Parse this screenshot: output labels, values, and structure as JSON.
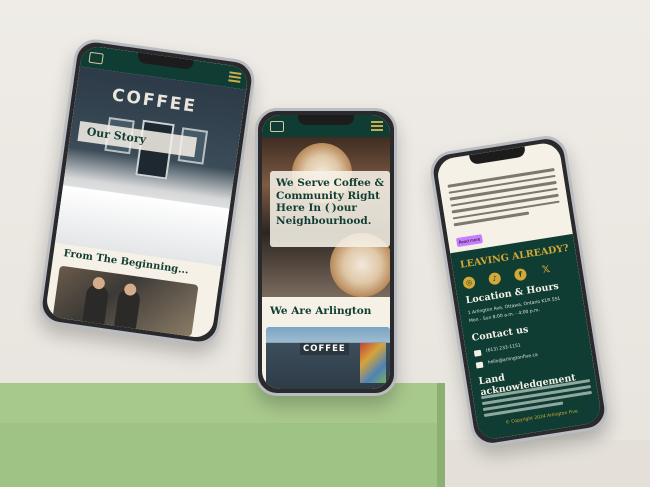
{
  "phone_left": {
    "hero_sign": "COFFEE",
    "section_title": "Our Story",
    "subsection_title": "From The Beginning..."
  },
  "phone_center": {
    "hero_sign": "COFFEE",
    "headline": "We Serve Coffee & Community Right Here In ( )our Neighbourhood.",
    "section_title": "We Are Arlington Five"
  },
  "phone_right": {
    "button_label": "Read more",
    "footer": {
      "leaving": "LEAVING ALREADY?",
      "socials": [
        "instagram-icon",
        "tiktok-icon",
        "facebook-icon",
        "x-icon"
      ],
      "location_heading": "Location & Hours",
      "address": "1 Arlington Ave, Ottawa, Ontario K1R 5S1",
      "hours": "Mon - Sun 8:00 a.m. - 4:00 p.m.",
      "contact_heading": "Contact us",
      "phone": "(613) 233-1151",
      "email": "hello@arlingtonfive.ca",
      "land_heading": "Land acknowledgement",
      "copyright": "© Copyright 2024 Arlington Five"
    }
  },
  "colors": {
    "brand_green": "#0f3d33",
    "accent_gold": "#d4a836",
    "cream": "#f6f1e7",
    "pedestal": "#a8c98c"
  }
}
